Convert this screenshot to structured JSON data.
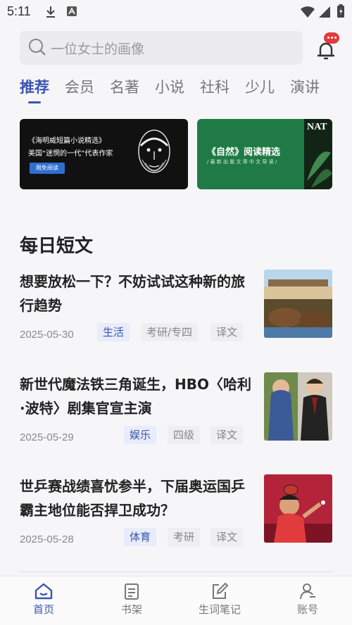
{
  "status_bar": {
    "time": "5:11"
  },
  "search": {
    "placeholder": "一位女士的画像"
  },
  "tabs": [
    {
      "label": "推荐",
      "active": true
    },
    {
      "label": "会员"
    },
    {
      "label": "名著"
    },
    {
      "label": "小说"
    },
    {
      "label": "社科"
    },
    {
      "label": "少儿"
    },
    {
      "label": "演讲"
    }
  ],
  "banners": [
    {
      "title": "《海明威短篇小说精选》",
      "subtitle": "美国“迷惘的一代”代表作家",
      "button": "限免阅读"
    },
    {
      "title": "《自然》阅读精选",
      "subtitle": "/ 最 新 出 版 文 章 中 文 导 读 /",
      "magazine": "NAT"
    }
  ],
  "section_title": "每日短文",
  "articles": [
    {
      "title": "想要放松一下？不妨试试这种新的旅行趋势",
      "date": "2025-05-30",
      "category": "生活",
      "level": "考研/专四",
      "translation": "译文",
      "thumb": "safari-photo"
    },
    {
      "title": "新世代魔法铁三角诞生，HBO〈哈利·波特〉剧集官宣主演",
      "date": "2025-05-29",
      "category": "娱乐",
      "level": "四级",
      "translation": "译文",
      "thumb": "actors-photo"
    },
    {
      "title": "世乒赛战绩喜忧参半，下届奥运国乒霸主地位能否捍卫成功？",
      "date": "2025-05-28",
      "category": "体育",
      "level": "考研",
      "translation": "译文",
      "thumb": "table-tennis-photo"
    }
  ],
  "bottom_nav": [
    {
      "label": "首页",
      "icon": "home-icon",
      "active": true
    },
    {
      "label": "书架",
      "icon": "bookshelf-icon"
    },
    {
      "label": "生词笔记",
      "icon": "notes-icon"
    },
    {
      "label": "账号",
      "icon": "account-icon"
    }
  ],
  "colors": {
    "accent": "#3a55b0",
    "badge": "#e23b3b",
    "tag_bg": "#e8ecfb"
  }
}
